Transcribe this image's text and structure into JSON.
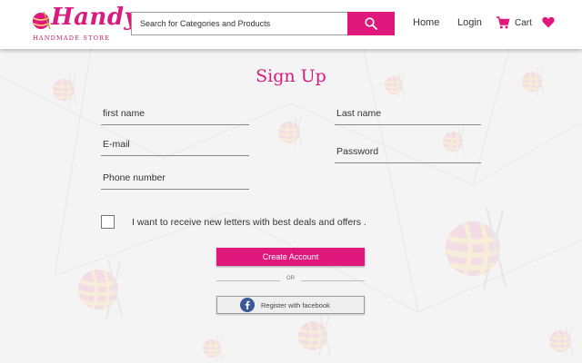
{
  "header": {
    "logo_text": "Handy",
    "logo_subtext": "HANDMADE STORE",
    "search_placeholder": "Search for Categories and Products",
    "nav": {
      "home": "Home",
      "login": "Login",
      "cart": "Cart"
    }
  },
  "form": {
    "title": "Sign Up",
    "first_name_placeholder": "first name",
    "last_name_placeholder": "Last name",
    "email_placeholder": "E-mail",
    "password_placeholder": "Password",
    "phone_placeholder": "Phone number",
    "newsletter_label": "I want to receive new letters with best deals and offers .",
    "create_button": "Create Account",
    "or_text": "OR",
    "facebook_button": "Register with facebook"
  },
  "colors": {
    "brand": "#e0177c",
    "facebook": "#3b5998"
  },
  "icons": [
    "search-icon",
    "cart-icon",
    "heart-icon",
    "facebook-icon",
    "yarn-ball-logo-icon"
  ]
}
